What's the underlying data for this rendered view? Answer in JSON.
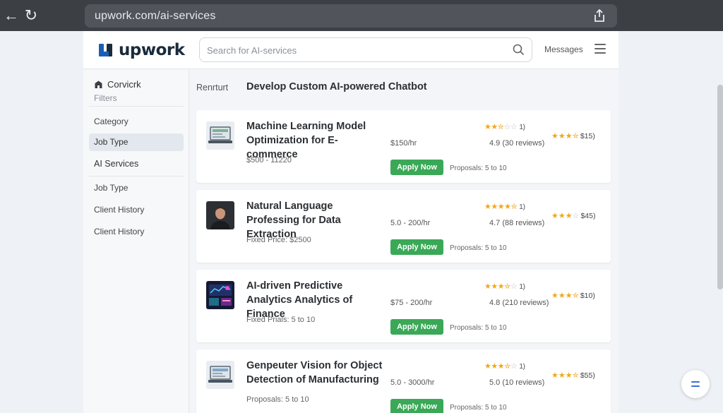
{
  "browser": {
    "url": "upwork.com/ai-services"
  },
  "header": {
    "logo_text": "upwork",
    "search_placeholder": "Search for AI-services",
    "messages_label": "Messages"
  },
  "sidebar": {
    "brand": "Corvicrk",
    "filters_label": "Filters",
    "items": [
      {
        "label": "Category"
      },
      {
        "label": "Job Type",
        "active": true
      },
      {
        "label": "AI Services"
      },
      {
        "label": "Job Type"
      },
      {
        "label": "Client History"
      },
      {
        "label": "Client History"
      }
    ]
  },
  "main": {
    "breadcrumb": "Renrturt",
    "title": "Develop Custom AI-powered Chatbot",
    "listings": [
      {
        "title": "Machine Learning Model Optimization for E-commerce",
        "budget": "$500 - 11220",
        "rate": "$150/hr",
        "apply_label": "Apply Now",
        "proposals": "Proposals: 5 to 10",
        "rating_count": "1)",
        "reviews": "4.9 (30 reviews)",
        "secondary_price": "$15)",
        "thumbnail": "laptop-screen-image",
        "rating_stars": 2.5,
        "secondary_stars": 3.5
      },
      {
        "title": "Natural Language Professing for Data Extraction",
        "budget": "Fixed Price: $2500",
        "rate": "5.0 - 200/hr",
        "apply_label": "Apply Now",
        "proposals": "Proposals: 5 to 10",
        "rating_count": "1)",
        "reviews": "4.7 (88 reviews)",
        "secondary_price": "$45)",
        "thumbnail": "person-portrait-image",
        "rating_stars": 4.5,
        "secondary_stars": 3
      },
      {
        "title": "AI-driven Predictive Analytics Analytics of Finance",
        "budget": "Fixed Prials: 5 to 10",
        "rate": "$75 - 200/hr",
        "apply_label": "Apply Now",
        "proposals": "Proposals: 5 to 10",
        "rating_count": "1)",
        "reviews": "4.8 (210 reviews)",
        "secondary_price": "$10)",
        "thumbnail": "neon-dashboard-image",
        "rating_stars": 3.5,
        "secondary_stars": 3.5
      },
      {
        "title": "Genpeuter Vision for Object Detection of Manufacturing",
        "budget": "Proposals: 5 to 10",
        "rate": "5.0 - 3000/hr",
        "apply_label": "Apply Now",
        "proposals": "Proposals: 5 to 10",
        "rating_count": "1)",
        "reviews": "5.0 (10 reviews)",
        "secondary_price": "$55)",
        "thumbnail": "laptop-screen-image",
        "rating_stars": 3.5,
        "secondary_stars": 3.5
      }
    ]
  },
  "colors": {
    "accent_green": "#3aa857",
    "star": "#f0a818",
    "chrome_bg": "#3c4045"
  }
}
